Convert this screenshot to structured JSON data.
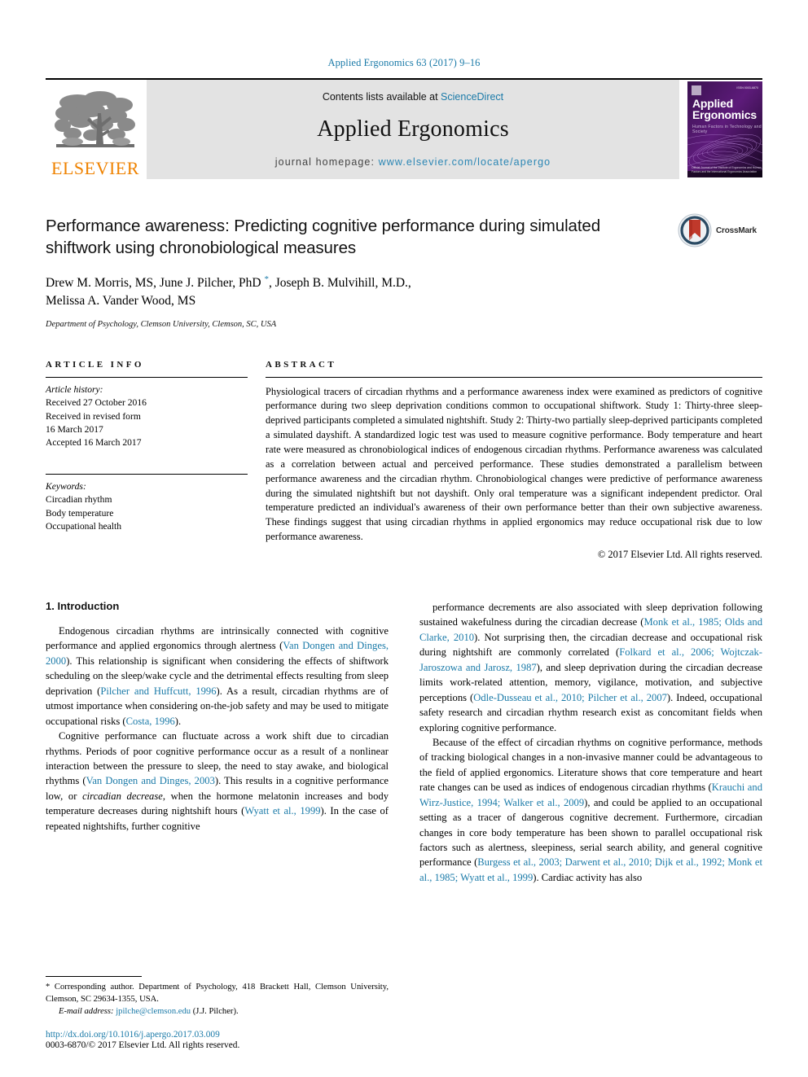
{
  "running_head": "Applied Ergonomics 63 (2017) 9–16",
  "masthead": {
    "publisher_logo_text": "ELSEVIER",
    "contents_prefix": "Contents lists available at ",
    "contents_link": "ScienceDirect",
    "journal_name": "Applied Ergonomics",
    "homepage_prefix": "journal homepage: ",
    "homepage_url": "www.elsevier.com/locate/apergo",
    "cover": {
      "title_line1": "Applied",
      "title_line2": "Ergonomics",
      "subtitle": "Human Factors in Technology and Society",
      "corner_text": "ISSN 0003-6870",
      "footer_text": "Official Journal of\nthe Institute of Ergonomics and Human Factors and the International Ergonomics Association"
    }
  },
  "article": {
    "title": "Performance awareness: Predicting cognitive performance during simulated shiftwork using chronobiological measures",
    "authors_line1_a": "Drew M. Morris, MS, June J. Pilcher, PhD ",
    "authors_star": "*",
    "authors_line1_b": ", Joseph B. Mulvihill, M.D.,",
    "authors_line2": "Melissa A. Vander Wood, MS",
    "affiliation": "Department of Psychology, Clemson University, Clemson, SC, USA",
    "crossmark_label": "CrossMark"
  },
  "article_info": {
    "heading": "ARTICLE INFO",
    "history_label": "Article history:",
    "history_lines": [
      "Received 27 October 2016",
      "Received in revised form",
      "16 March 2017",
      "Accepted 16 March 2017"
    ],
    "keywords_label": "Keywords:",
    "keywords": [
      "Circadian rhythm",
      "Body temperature",
      "Occupational health"
    ]
  },
  "abstract": {
    "heading": "ABSTRACT",
    "text": "Physiological tracers of circadian rhythms and a performance awareness index were examined as predictors of cognitive performance during two sleep deprivation conditions common to occupational shiftwork. Study 1: Thirty-three sleep-deprived participants completed a simulated nightshift. Study 2: Thirty-two partially sleep-deprived participants completed a simulated dayshift. A standardized logic test was used to measure cognitive performance. Body temperature and heart rate were measured as chronobiological indices of endogenous circadian rhythms. Performance awareness was calculated as a correlation between actual and perceived performance. These studies demonstrated a parallelism between performance awareness and the circadian rhythm. Chronobiological changes were predictive of performance awareness during the simulated nightshift but not dayshift. Only oral temperature was a significant independent predictor. Oral temperature predicted an individual's awareness of their own performance better than their own subjective awareness. These findings suggest that using circadian rhythms in applied ergonomics may reduce occupational risk due to low performance awareness.",
    "copyright": "© 2017 Elsevier Ltd. All rights reserved."
  },
  "introduction": {
    "section_title": "1. Introduction",
    "left_paragraphs": [
      {
        "runs": [
          {
            "t": "Endogenous circadian rhythms are intrinsically connected with cognitive performance and applied ergonomics through alertness ("
          },
          {
            "t": "Van Dongen and Dinges, 2000",
            "k": "ref"
          },
          {
            "t": "). This relationship is significant when considering the effects of shiftwork scheduling on the sleep/wake cycle and the detrimental effects resulting from sleep deprivation ("
          },
          {
            "t": "Pilcher and Huffcutt, 1996",
            "k": "ref"
          },
          {
            "t": "). As a result, circadian rhythms are of utmost importance when considering on-the-job safety and may be used to mitigate occupational risks ("
          },
          {
            "t": "Costa, 1996",
            "k": "ref"
          },
          {
            "t": ")."
          }
        ]
      },
      {
        "runs": [
          {
            "t": "Cognitive performance can fluctuate across a work shift due to circadian rhythms. Periods of poor cognitive performance occur as a result of a nonlinear interaction between the pressure to sleep, the need to stay awake, and biological rhythms ("
          },
          {
            "t": "Van Dongen and Dinges, 2003",
            "k": "ref"
          },
          {
            "t": "). This results in a cognitive performance low, or "
          },
          {
            "t": "circadian decrease",
            "k": "ital"
          },
          {
            "t": ", when the hormone melatonin increases and body temperature decreases during nightshift hours ("
          },
          {
            "t": "Wyatt et al., 1999",
            "k": "ref"
          },
          {
            "t": "). In the case of repeated nightshifts, further cognitive"
          }
        ]
      }
    ],
    "right_paragraphs": [
      {
        "runs": [
          {
            "t": "performance decrements are also associated with sleep deprivation following sustained wakefulness during the circadian decrease ("
          },
          {
            "t": "Monk et al., 1985; Olds and Clarke, 2010",
            "k": "ref"
          },
          {
            "t": "). Not surprising then, the circadian decrease and occupational risk during nightshift are commonly correlated ("
          },
          {
            "t": "Folkard et al., 2006; Wojtczak-Jaroszowa and Jarosz, 1987",
            "k": "ref"
          },
          {
            "t": "), and sleep deprivation during the circadian decrease limits work-related attention, memory, vigilance, motivation, and subjective perceptions ("
          },
          {
            "t": "Odle-Dusseau et al., 2010; Pilcher et al., 2007",
            "k": "ref"
          },
          {
            "t": "). Indeed, occupational safety research and circadian rhythm research exist as concomitant fields when exploring cognitive performance."
          }
        ]
      },
      {
        "runs": [
          {
            "t": "Because of the effect of circadian rhythms on cognitive performance, methods of tracking biological changes in a non-invasive manner could be advantageous to the field of applied ergonomics. Literature shows that core temperature and heart rate changes can be used as indices of endogenous circadian rhythms ("
          },
          {
            "t": "Krauchi and Wirz-Justice, 1994; Walker et al., 2009",
            "k": "ref"
          },
          {
            "t": "), and could be applied to an occupational setting as a tracer of dangerous cognitive decrement. Furthermore, circadian changes in core body temperature has been shown to parallel occupational risk factors such as alertness, sleepiness, serial search ability, and general cognitive performance ("
          },
          {
            "t": "Burgess et al., 2003; Darwent et al., 2010; Dijk et al., 1992; Monk et al., 1985; Wyatt et al., 1999",
            "k": "ref"
          },
          {
            "t": "). Cardiac activity has also"
          }
        ]
      }
    ]
  },
  "footnotes": {
    "corresponding": "* Corresponding author. Department of Psychology, 418 Brackett Hall, Clemson University, Clemson, SC 29634-1355, USA.",
    "email_label": "E-mail address:",
    "email": "jpilche@clemson.edu",
    "email_suffix": "(J.J. Pilcher).",
    "doi": "http://dx.doi.org/10.1016/j.apergo.2017.03.009",
    "issn_line": "0003-6870/© 2017 Elsevier Ltd. All rights reserved."
  },
  "colors": {
    "link": "#1a7aa8",
    "elsevier_orange": "#ef8200",
    "masthead_bg": "#e3e3e3"
  }
}
